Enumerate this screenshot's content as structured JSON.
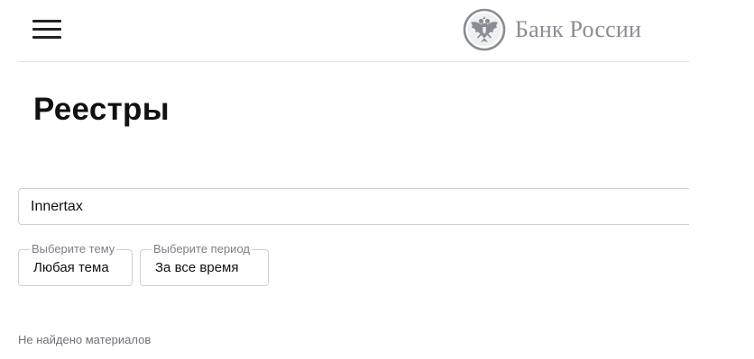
{
  "header": {
    "menu_icon": "hamburger-menu-icon",
    "brand": {
      "name": "Банк России",
      "logo_icon": "double-headed-eagle-emblem-icon",
      "color": "#8a8d93"
    }
  },
  "main": {
    "title": "Реестры",
    "search": {
      "value": "Innertax",
      "placeholder": ""
    },
    "filters": {
      "topic": {
        "label": "Выберите тему",
        "value": "Любая тема"
      },
      "period": {
        "label": "Выберите период",
        "value": "За все время"
      }
    },
    "empty_message": "Не найдено материалов"
  }
}
